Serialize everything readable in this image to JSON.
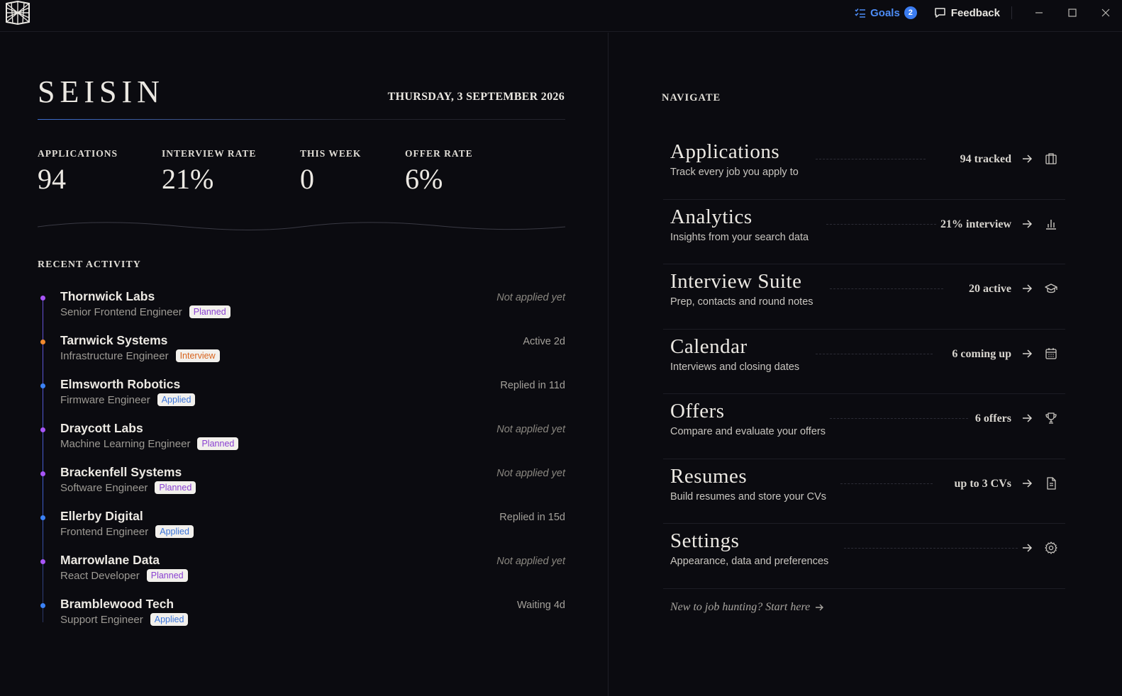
{
  "titlebar": {
    "goals_label": "Goals",
    "goals_count": "2",
    "feedback_label": "Feedback"
  },
  "header": {
    "brand": "SEISIN",
    "date": "THURSDAY, 3 SEPTEMBER 2026"
  },
  "stats": [
    {
      "label": "APPLICATIONS",
      "value": "94"
    },
    {
      "label": "INTERVIEW RATE",
      "value": "21%"
    },
    {
      "label": "THIS WEEK",
      "value": "0"
    },
    {
      "label": "OFFER RATE",
      "value": "6%"
    }
  ],
  "recent": {
    "title": "RECENT ACTIVITY",
    "items": [
      {
        "company": "Thornwick Labs",
        "role": "Senior Frontend Engineer",
        "tag": "Planned",
        "status": "Not applied yet"
      },
      {
        "company": "Tarnwick Systems",
        "role": "Infrastructure Engineer",
        "tag": "Interview",
        "status": "Active 2d"
      },
      {
        "company": "Elmsworth Robotics",
        "role": "Firmware Engineer",
        "tag": "Applied",
        "status": "Replied in 11d"
      },
      {
        "company": "Draycott Labs",
        "role": "Machine Learning Engineer",
        "tag": "Planned",
        "status": "Not applied yet"
      },
      {
        "company": "Brackenfell Systems",
        "role": "Software Engineer",
        "tag": "Planned",
        "status": "Not applied yet"
      },
      {
        "company": "Ellerby Digital",
        "role": "Frontend Engineer",
        "tag": "Applied",
        "status": "Replied in 15d"
      },
      {
        "company": "Marrowlane Data",
        "role": "React Developer",
        "tag": "Planned",
        "status": "Not applied yet"
      },
      {
        "company": "Bramblewood Tech",
        "role": "Support Engineer",
        "tag": "Applied",
        "status": "Waiting 4d"
      }
    ]
  },
  "navigate": {
    "title": "NAVIGATE",
    "items": [
      {
        "name": "Applications",
        "desc": "Track every job you apply to",
        "meta": "94 tracked",
        "icon": "briefcase-icon"
      },
      {
        "name": "Analytics",
        "desc": "Insights from your search data",
        "meta": "21% interview",
        "icon": "bar-chart-icon"
      },
      {
        "name": "Interview Suite",
        "desc": "Prep, contacts and round notes",
        "meta": "20 active",
        "icon": "graduation-cap-icon"
      },
      {
        "name": "Calendar",
        "desc": "Interviews and closing dates",
        "meta": "6 coming up",
        "icon": "calendar-icon"
      },
      {
        "name": "Offers",
        "desc": "Compare and evaluate your offers",
        "meta": "6 offers",
        "icon": "trophy-icon"
      },
      {
        "name": "Resumes",
        "desc": "Build resumes and store your CVs",
        "meta": "up to 3 CVs",
        "icon": "document-icon"
      },
      {
        "name": "Settings",
        "desc": "Appearance, data and preferences",
        "meta": "",
        "icon": "gear-icon"
      }
    ],
    "start_link": "New to job hunting? Start here"
  },
  "colors": {
    "planned": "#a855f7",
    "interview": "#f28a2e",
    "applied": "#3b82f6",
    "accent": "#3b7cf0"
  }
}
